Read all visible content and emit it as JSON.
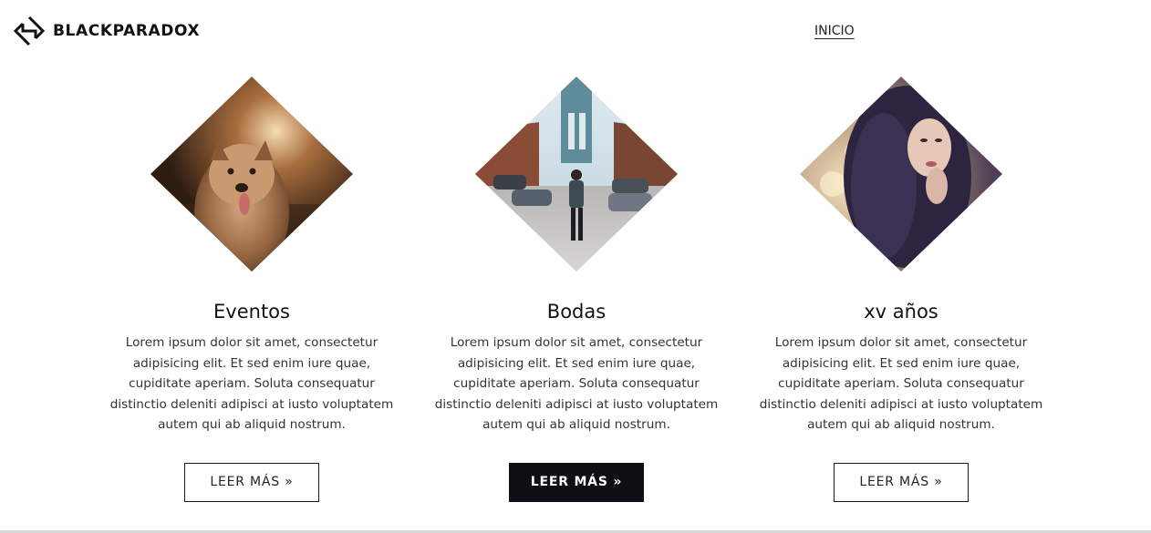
{
  "header": {
    "brand": "BLACKPARADOX",
    "logo_icon": "diamond-arrows-logo-icon",
    "nav": {
      "home_label": "INICIO"
    }
  },
  "cards": [
    {
      "title": "Eventos",
      "image": "dog-portrait-photo",
      "text": "Lorem ipsum dolor sit amet, consectetur adipisicing elit. Et sed enim iure quae, cupiditate aperiam. Soluta consequatur distinctio deleniti adipisci at iusto voluptatem autem qui ab aliquid nostrum.",
      "button_label": "LEER MÁS »",
      "button_style": "outline"
    },
    {
      "title": "Bodas",
      "image": "city-bridge-street-photo",
      "text": "Lorem ipsum dolor sit amet, consectetur adipisicing elit. Et sed enim iure quae, cupiditate aperiam. Soluta consequatur distinctio deleniti adipisci at iusto voluptatem autem qui ab aliquid nostrum.",
      "button_label": "LEER MÁS »",
      "button_style": "filled"
    },
    {
      "title": "xv años",
      "image": "woman-curly-hair-photo",
      "text": "Lorem ipsum dolor sit amet, consectetur adipisicing elit. Et sed enim iure quae, cupiditate aperiam. Soluta consequatur distinctio deleniti adipisci at iusto voluptatem autem qui ab aliquid nostrum.",
      "button_label": "LEER MÁS »",
      "button_style": "outline"
    }
  ],
  "colors": {
    "primary_dark": "#0c0f14",
    "text": "#333333",
    "background": "#ffffff"
  }
}
